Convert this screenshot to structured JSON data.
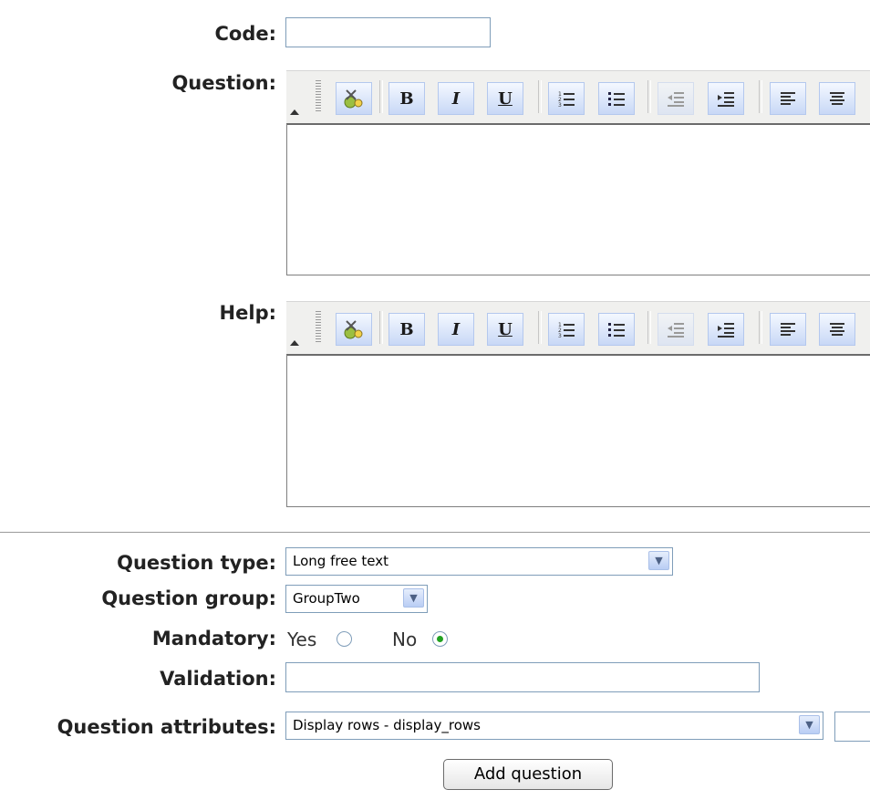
{
  "form": {
    "code_label": "Code:",
    "code_value": "",
    "question_label": "Question:",
    "help_label": "Help:",
    "question_type_label": "Question type:",
    "question_type_value": "Long free text",
    "question_group_label": "Question group:",
    "question_group_value": "GroupTwo",
    "mandatory_label": "Mandatory:",
    "mandatory_yes": "Yes",
    "mandatory_no": "No",
    "mandatory_selected": "No",
    "validation_label": "Validation:",
    "validation_value": "",
    "attributes_label": "Question attributes:",
    "attributes_value": "Display rows - display_rows",
    "add_button": "Add question"
  },
  "toolbar_buttons": [
    "bold",
    "italic",
    "underline",
    "ordered-list",
    "unordered-list",
    "outdent",
    "indent",
    "align-left",
    "align-center"
  ],
  "toolbar_text": {
    "bold": "B",
    "italic": "I",
    "underline": "U"
  }
}
